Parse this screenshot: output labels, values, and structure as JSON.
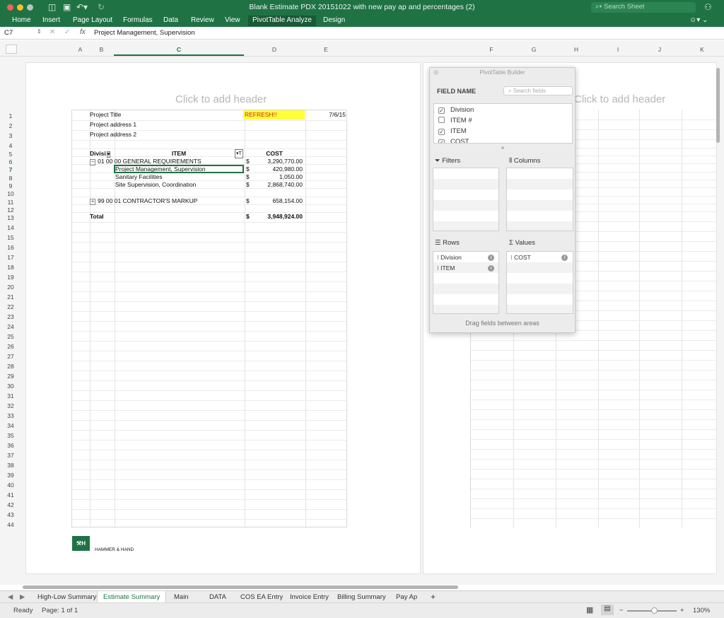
{
  "window": {
    "title": "Blank Estimate PDX 20151022 with new pay ap and percentages (2)",
    "search_placeholder": "Search Sheet"
  },
  "ribbon": {
    "tabs": [
      "Home",
      "Insert",
      "Page Layout",
      "Formulas",
      "Data",
      "Review",
      "View",
      "PivotTable Analyze",
      "Design"
    ],
    "active": "PivotTable Analyze"
  },
  "formula_bar": {
    "cell_ref": "C7",
    "fx": "fx",
    "value": "Project Management, Supervision"
  },
  "columns": [
    "A",
    "B",
    "C",
    "D",
    "E",
    "F",
    "G",
    "H",
    "I",
    "J",
    "K"
  ],
  "active_column": "C",
  "rows": {
    "start": 1,
    "end": 44,
    "active": 7
  },
  "header_placeholder": "Click to add header",
  "sheet": {
    "project_title": "Project Title",
    "refresh": "REFRESH!!",
    "date": "7/6/15",
    "address1": "Project address 1",
    "address2": "Project address 2",
    "col_headers": {
      "division": "Divisi",
      "item": "ITEM",
      "cost": "COST"
    },
    "group1": "01 00 00 GENERAL REQUIREMENTS",
    "group1_cur": "$",
    "group1_cost": "3,290,770.00",
    "items": [
      {
        "label": "Project Management, Supervision",
        "cur": "$",
        "cost": "420,980.00"
      },
      {
        "label": "Sanitary Facilities",
        "cur": "$",
        "cost": "1,050.00"
      },
      {
        "label": "Site Supervision, Coordination",
        "cur": "$",
        "cost": "2,868,740.00"
      }
    ],
    "group2": "99 00 01 CONTRACTOR'S MARKUP",
    "group2_cur": "$",
    "group2_cost": "658,154.00",
    "total_label": "Total",
    "total_cur": "$",
    "total_cost": "3,948,924.00",
    "logo_text": "HAMMER & HAND"
  },
  "pivot": {
    "title": "PivotTable Builder",
    "field_name": "FIELD NAME",
    "search_placeholder": "Search fields",
    "fields": [
      {
        "name": "Division",
        "checked": true
      },
      {
        "name": "ITEM #",
        "checked": false
      },
      {
        "name": "ITEM",
        "checked": true
      },
      {
        "name": "COST",
        "checked": true
      }
    ],
    "filters_label": "Filters",
    "columns_label": "Columns",
    "rows_label": "Rows",
    "values_label": "Values",
    "rows_items": [
      "Division",
      "ITEM"
    ],
    "values_items": [
      "COST"
    ],
    "hint": "Drag fields between areas"
  },
  "sheet_tabs": [
    "High-Low Summary",
    "Estimate Summary",
    "Main",
    "DATA",
    "COS EA Entry",
    "Invoice Entry",
    "Billing Summary",
    "Pay Ap"
  ],
  "active_tab": "Estimate Summary",
  "status": {
    "mode": "Ready",
    "page": "Page: 1 of 1",
    "zoom": "130%"
  },
  "colors": {
    "excel_green": "#1f7244",
    "refresh_bg": "#ffff3a",
    "refresh_fg": "#d02020"
  }
}
